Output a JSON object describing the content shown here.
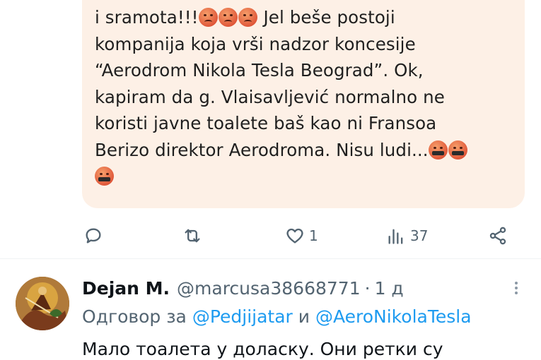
{
  "quoted_post": {
    "lines": [
      "i sramota!!!",
      "Jel beše postoji",
      "kompanija koja vrši nadzor koncesije",
      "“Aerodrom Nikola Tesla Beograd”. Ok,",
      "kapiram da g. Vlaisavljević normalno ne",
      "koristi javne toalete baš kao ni Fransoa",
      "Berizo direktor Aerodroma. Nisu ludi..."
    ]
  },
  "actions": {
    "reply_icon": "reply-icon",
    "repost_icon": "repost-icon",
    "like_icon": "heart-icon",
    "like_count": "1",
    "views_icon": "views-icon",
    "views_count": "37",
    "share_icon": "share-icon"
  },
  "reply": {
    "author_name": "Dejan M.",
    "handle": "@marcusa38668771",
    "separator": "·",
    "time": "1 д",
    "replying_prefix": "Одговор за",
    "mention_1": "@Pedjijatar",
    "conjunction": "и",
    "mention_2": "@AeroNikolaTesla",
    "body_start": "Мало тоалета у доласку. Они ретки су"
  },
  "colors": {
    "bubble_bg": "#fdf0e6",
    "secondary_text": "#536471",
    "link": "#1d9bf0"
  }
}
